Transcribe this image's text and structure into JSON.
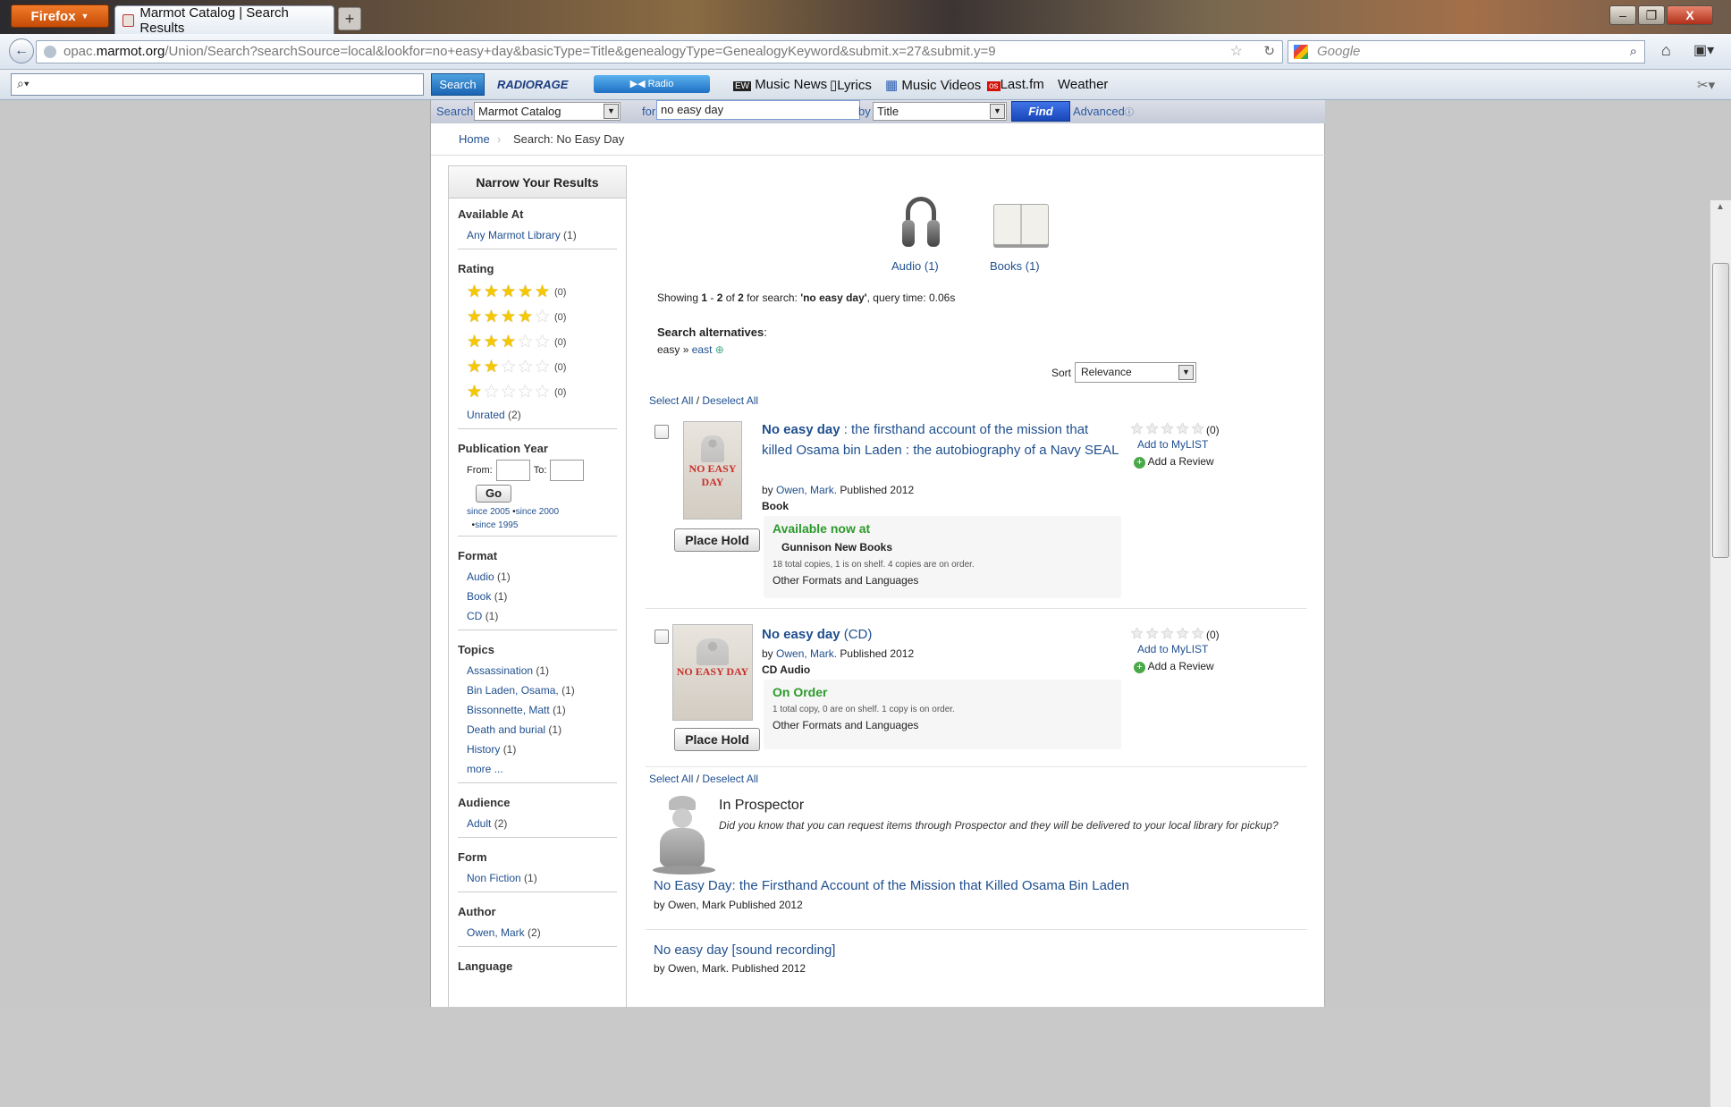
{
  "browser": {
    "menu_label": "Firefox",
    "tab_title": "Marmot Catalog | Search Results",
    "new_tab": "+",
    "url_prefix": "opac.",
    "url_domain": "marmot.org",
    "url_rest": "/Union/Search?searchSource=local&lookfor=no+easy+day&basicType=Title&genealogyType=GenealogyKeyword&submit.x=27&submit.y=9",
    "search_engine": "Google",
    "minimize": "–",
    "restore": "❐",
    "close": "X"
  },
  "toolbar": {
    "search_btn": "Search",
    "brand": "RADIORAGE",
    "radio": "Radio",
    "items": [
      "Music News",
      "Lyrics",
      "Music Videos",
      "Last.fm",
      "Weather"
    ]
  },
  "catalog_search": {
    "label": "Search",
    "scope": "Marmot Catalog",
    "for_label": "for",
    "query": "no easy day",
    "by_label": "by",
    "by_value": "Title",
    "find": "Find",
    "advanced": "Advanced"
  },
  "breadcrumb": {
    "home": "Home",
    "current": "Search: No Easy Day"
  },
  "sidebar": {
    "title": "Narrow Your Results",
    "available": {
      "heading": "Available At",
      "items": [
        {
          "label": "Any Marmot Library",
          "count": "(1)"
        }
      ]
    },
    "rating": {
      "heading": "Rating",
      "rows": [
        {
          "stars": 5,
          "count": "(0)"
        },
        {
          "stars": 4,
          "count": "(0)"
        },
        {
          "stars": 3,
          "count": "(0)"
        },
        {
          "stars": 2,
          "count": "(0)"
        },
        {
          "stars": 1,
          "count": "(0)"
        }
      ],
      "unrated": "Unrated",
      "unrated_count": "(2)"
    },
    "pubyear": {
      "heading": "Publication Year",
      "from": "From:",
      "to": "To:",
      "go": "Go",
      "since1": "since 2005",
      "since2": "since 2000",
      "since3": "since 1995"
    },
    "format": {
      "heading": "Format",
      "items": [
        {
          "label": "Audio",
          "count": "(1)"
        },
        {
          "label": "Book",
          "count": "(1)"
        },
        {
          "label": "CD",
          "count": "(1)"
        }
      ]
    },
    "topics": {
      "heading": "Topics",
      "items": [
        {
          "label": "Assassination",
          "count": "(1)"
        },
        {
          "label": "Bin Laden, Osama,",
          "count": "(1)"
        },
        {
          "label": "Bissonnette, Matt",
          "count": "(1)"
        },
        {
          "label": "Death and burial",
          "count": "(1)"
        },
        {
          "label": "History",
          "count": "(1)"
        }
      ],
      "more": "more ..."
    },
    "audience": {
      "heading": "Audience",
      "items": [
        {
          "label": "Adult",
          "count": "(2)"
        }
      ]
    },
    "form": {
      "heading": "Form",
      "items": [
        {
          "label": "Non Fiction",
          "count": "(1)"
        }
      ]
    },
    "author": {
      "heading": "Author",
      "items": [
        {
          "label": "Owen, Mark",
          "count": "(2)"
        }
      ]
    },
    "language": {
      "heading": "Language"
    }
  },
  "formats": {
    "audio": "Audio (1)",
    "books": "Books (1)"
  },
  "summary": {
    "showing": "Showing",
    "from": "1",
    "dash": "-",
    "to": "2",
    "of": "of",
    "total": "2",
    "for": "for search:",
    "query": "'no easy day'",
    "time": ", query time: 0.06s"
  },
  "alternatives": {
    "heading": "Search alternatives",
    "word": "easy",
    "arrow": "»",
    "alt": "east"
  },
  "sort": {
    "label": "Sort",
    "value": "Relevance"
  },
  "select_all": "Select All",
  "deselect_all": "Deselect All",
  "slash": "/",
  "results": [
    {
      "title_main": "No easy day",
      "title_rest": " : the firsthand account of the mission that killed Osama bin Laden : the autobiography of a Navy SEAL",
      "by": "by",
      "author": "Owen, Mark.",
      "published": "Published 2012",
      "format": "Book",
      "status": "Available now at",
      "location": "Gunnison New Books",
      "copies": "18 total copies, 1 is on shelf. 4 copies are on order.",
      "other": "Other Formats and Languages",
      "hold": "Place Hold",
      "rating": "(0)",
      "mylist": "Add to MyLIST",
      "review": "Add a Review",
      "cover_text": "NO EASY DAY"
    },
    {
      "title_main": "No easy day",
      "title_rest": " (CD)",
      "by": "by",
      "author": "Owen, Mark.",
      "published": "Published 2012",
      "format": "CD Audio",
      "status": "On Order",
      "copies": "1 total copy, 0 are on shelf. 1 copy is on order.",
      "other": "Other Formats and Languages",
      "hold": "Place Hold",
      "rating": "(0)",
      "mylist": "Add to MyLIST",
      "review": "Add a Review",
      "cover_text": "NO EASY DAY"
    }
  ],
  "prospector": {
    "heading": "In Prospector",
    "text": "Did you know that you can request items through Prospector and they will be delivered to your local library for pickup?",
    "items": [
      {
        "title": "No Easy Day: the Firsthand Account of the Mission that Killed Osama Bin Laden",
        "byline": "by Owen, Mark Published 2012"
      },
      {
        "title": "No easy day [sound recording]",
        "byline": "by Owen, Mark. Published 2012"
      }
    ]
  },
  "colors": {
    "link": "#1f4f8f",
    "available": "#2c9a2c",
    "search_strip": "#c5cad8"
  }
}
